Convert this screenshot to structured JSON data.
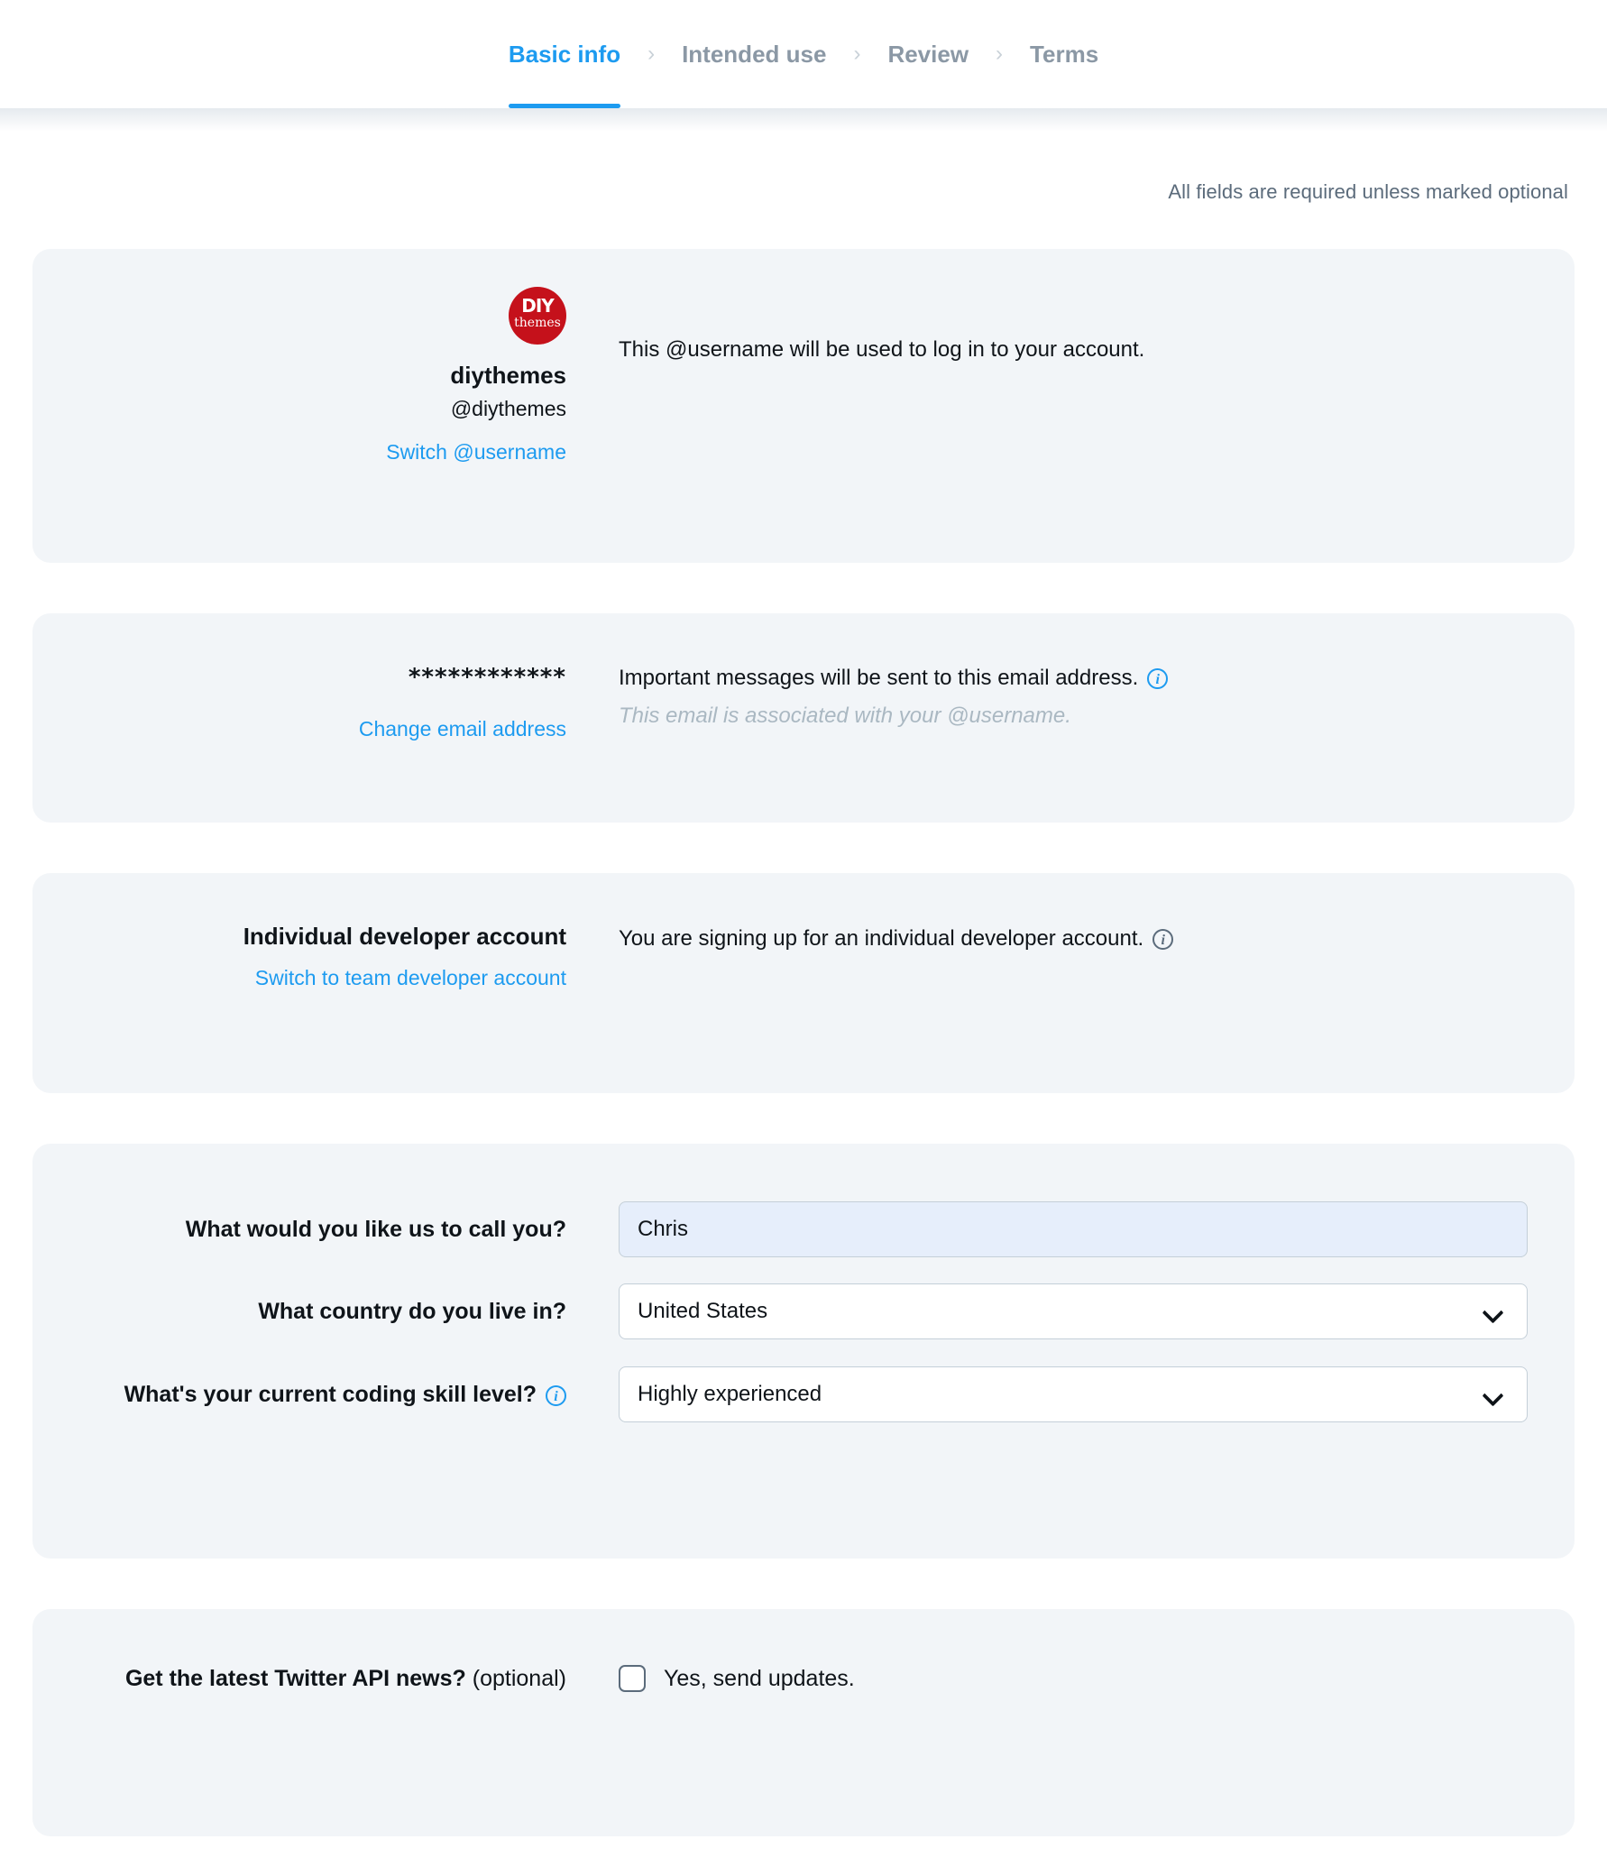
{
  "stepbar": {
    "separator": "›",
    "steps": [
      {
        "label": "Basic info",
        "active": true
      },
      {
        "label": "Intended use",
        "active": false
      },
      {
        "label": "Review",
        "active": false
      },
      {
        "label": "Terms",
        "active": false
      }
    ]
  },
  "page": {
    "required_note": "All fields are required unless marked optional"
  },
  "username_card": {
    "avatar": {
      "top_text": "DIY",
      "bottom_text": "themes",
      "color": "#c5111b"
    },
    "display_name": "diythemes",
    "handle": "@diythemes",
    "switch_link": "Switch @username",
    "description": "This @username will be used to log in to your account."
  },
  "email_card": {
    "masked_email": "************",
    "change_link": "Change email address",
    "description": "Important messages will be sent to this email address.",
    "info_icon": "info-icon",
    "note": "This email is associated with your @username."
  },
  "account_type_card": {
    "label": "Individual developer account",
    "switch_link": "Switch to team developer account",
    "description": "You are signing up for an individual developer account.",
    "info_icon": "info-icon"
  },
  "form_card": {
    "fields": [
      {
        "label": "What would you like us to call you?",
        "type": "text",
        "value": "Chris",
        "placeholder": ""
      },
      {
        "label": "What country do you live in?",
        "type": "select",
        "value": "United States"
      },
      {
        "label": "What's your current coding skill level?",
        "type": "select",
        "value": "Highly experienced",
        "info_icon": "info-icon"
      }
    ]
  },
  "newsletter_card": {
    "label": "Get the latest Twitter API news?",
    "optional_suffix": "(optional)",
    "checkbox_label": "Yes, send updates.",
    "checked": false
  },
  "colors": {
    "accent": "#1d9bf0",
    "card_bg": "#f2f5f8",
    "text": "#0f1419",
    "muted": "#5b6b7b",
    "placeholder_muted": "#aab8c2",
    "input_focus_bg": "#e6eefb",
    "border": "#c4cfd8"
  }
}
